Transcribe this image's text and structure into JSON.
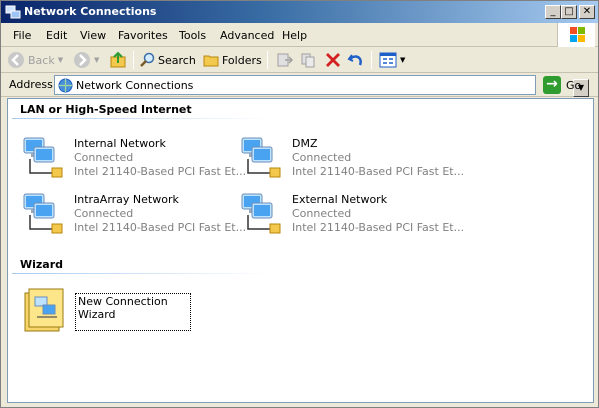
{
  "window": {
    "title": "Network Connections",
    "min_glyph": "_",
    "max_glyph": "□",
    "close_glyph": "✕"
  },
  "menu": {
    "items": [
      {
        "label": "File"
      },
      {
        "label": "Edit"
      },
      {
        "label": "View"
      },
      {
        "label": "Favorites"
      },
      {
        "label": "Tools"
      },
      {
        "label": "Advanced"
      },
      {
        "label": "Help"
      }
    ]
  },
  "toolbar": {
    "back_label": "Back",
    "search_label": "Search",
    "folders_label": "Folders"
  },
  "address": {
    "label": "Address",
    "value": "Network Connections",
    "go_label": "Go"
  },
  "groups": {
    "lan": {
      "header": "LAN or High-Speed Internet",
      "connections": [
        {
          "name": "Internal Network",
          "status": "Connected",
          "device": "Intel 21140-Based PCI Fast Et..."
        },
        {
          "name": "DMZ",
          "status": "Connected",
          "device": "Intel 21140-Based PCI Fast Et..."
        },
        {
          "name": "IntraArray Network",
          "status": "Connected",
          "device": "Intel 21140-Based PCI Fast Et..."
        },
        {
          "name": "External Network",
          "status": "Connected",
          "device": "Intel 21140-Based PCI Fast Et..."
        }
      ]
    },
    "wizard": {
      "header": "Wizard",
      "item_label": "New Connection Wizard"
    }
  },
  "colors": {
    "title_bar_start": "#0a246a",
    "title_bar_end": "#a6caf0",
    "window_bg": "#ece9d8",
    "status_text": "#808080"
  }
}
